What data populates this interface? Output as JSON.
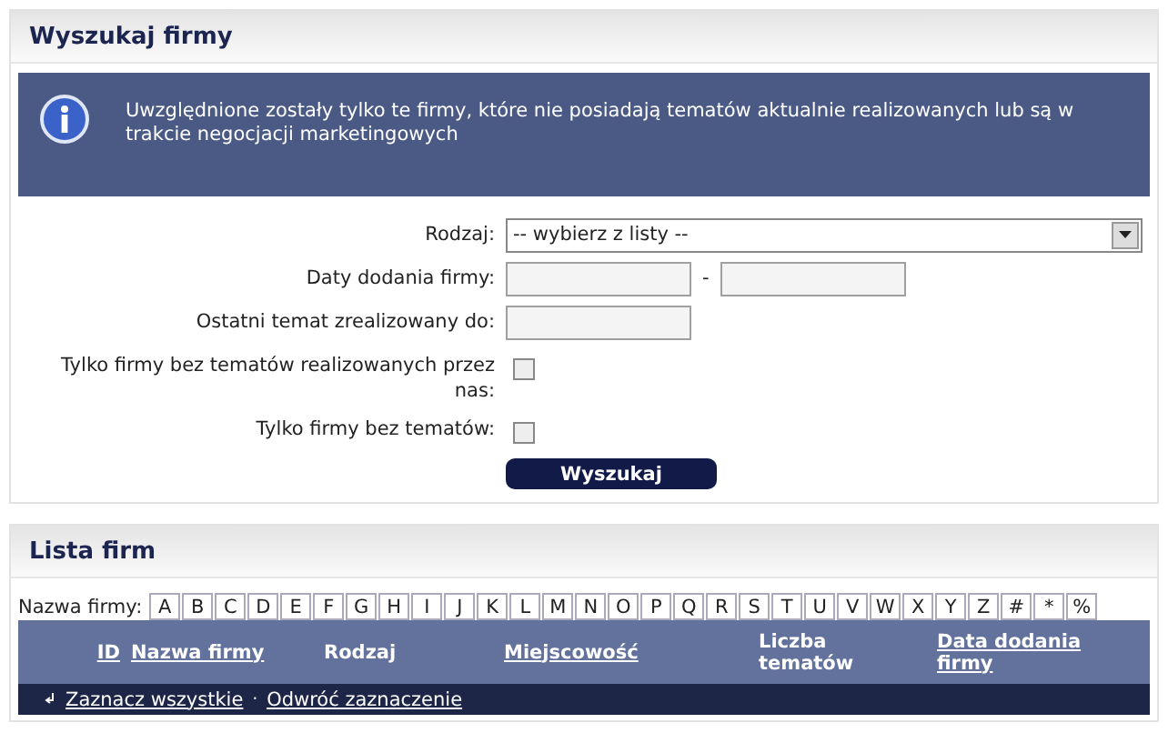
{
  "search_panel": {
    "title": "Wyszukaj firmy",
    "info": "Uwzględnione zostały tylko te firmy, które nie posiadają tematów aktualnie realizowanych lub są w trakcie negocjacji marketingowych",
    "fields": [
      {
        "kind": "select",
        "label": "Rodzaj:",
        "value": "-- wybierz z listy --"
      },
      {
        "kind": "range",
        "label": "Daty dodania firmy:",
        "separator": "-"
      },
      {
        "kind": "text",
        "label": "Ostatni temat zrealizowany do:"
      },
      {
        "kind": "checkbox",
        "label": "Tylko firmy bez tematów realizowanych przez nas:",
        "checked": false
      },
      {
        "kind": "checkbox",
        "label": "Tylko firmy bez tematów:",
        "checked": false
      }
    ],
    "button": "Wyszukaj"
  },
  "list_panel": {
    "title": "Lista firm",
    "filter_label": "Nazwa firmy:",
    "letters": [
      "A",
      "B",
      "C",
      "D",
      "E",
      "F",
      "G",
      "H",
      "I",
      "J",
      "K",
      "L",
      "M",
      "N",
      "O",
      "P",
      "Q",
      "R",
      "S",
      "T",
      "U",
      "V",
      "W",
      "X",
      "Y",
      "Z",
      "#",
      "*",
      "%"
    ],
    "columns": [
      {
        "label": "ID",
        "sortable": true
      },
      {
        "label": "Nazwa firmy",
        "sortable": true
      },
      {
        "label": "Rodzaj",
        "sortable": false
      },
      {
        "label": "Miejscowość",
        "sortable": true
      },
      {
        "label": "Liczba tematów",
        "sortable": false
      },
      {
        "label": "Data dodania firmy",
        "sortable": true
      }
    ],
    "actions": [
      "Zaznacz wszystkie",
      "Odwróć zaznaczenie"
    ],
    "action_separator": "·"
  }
}
